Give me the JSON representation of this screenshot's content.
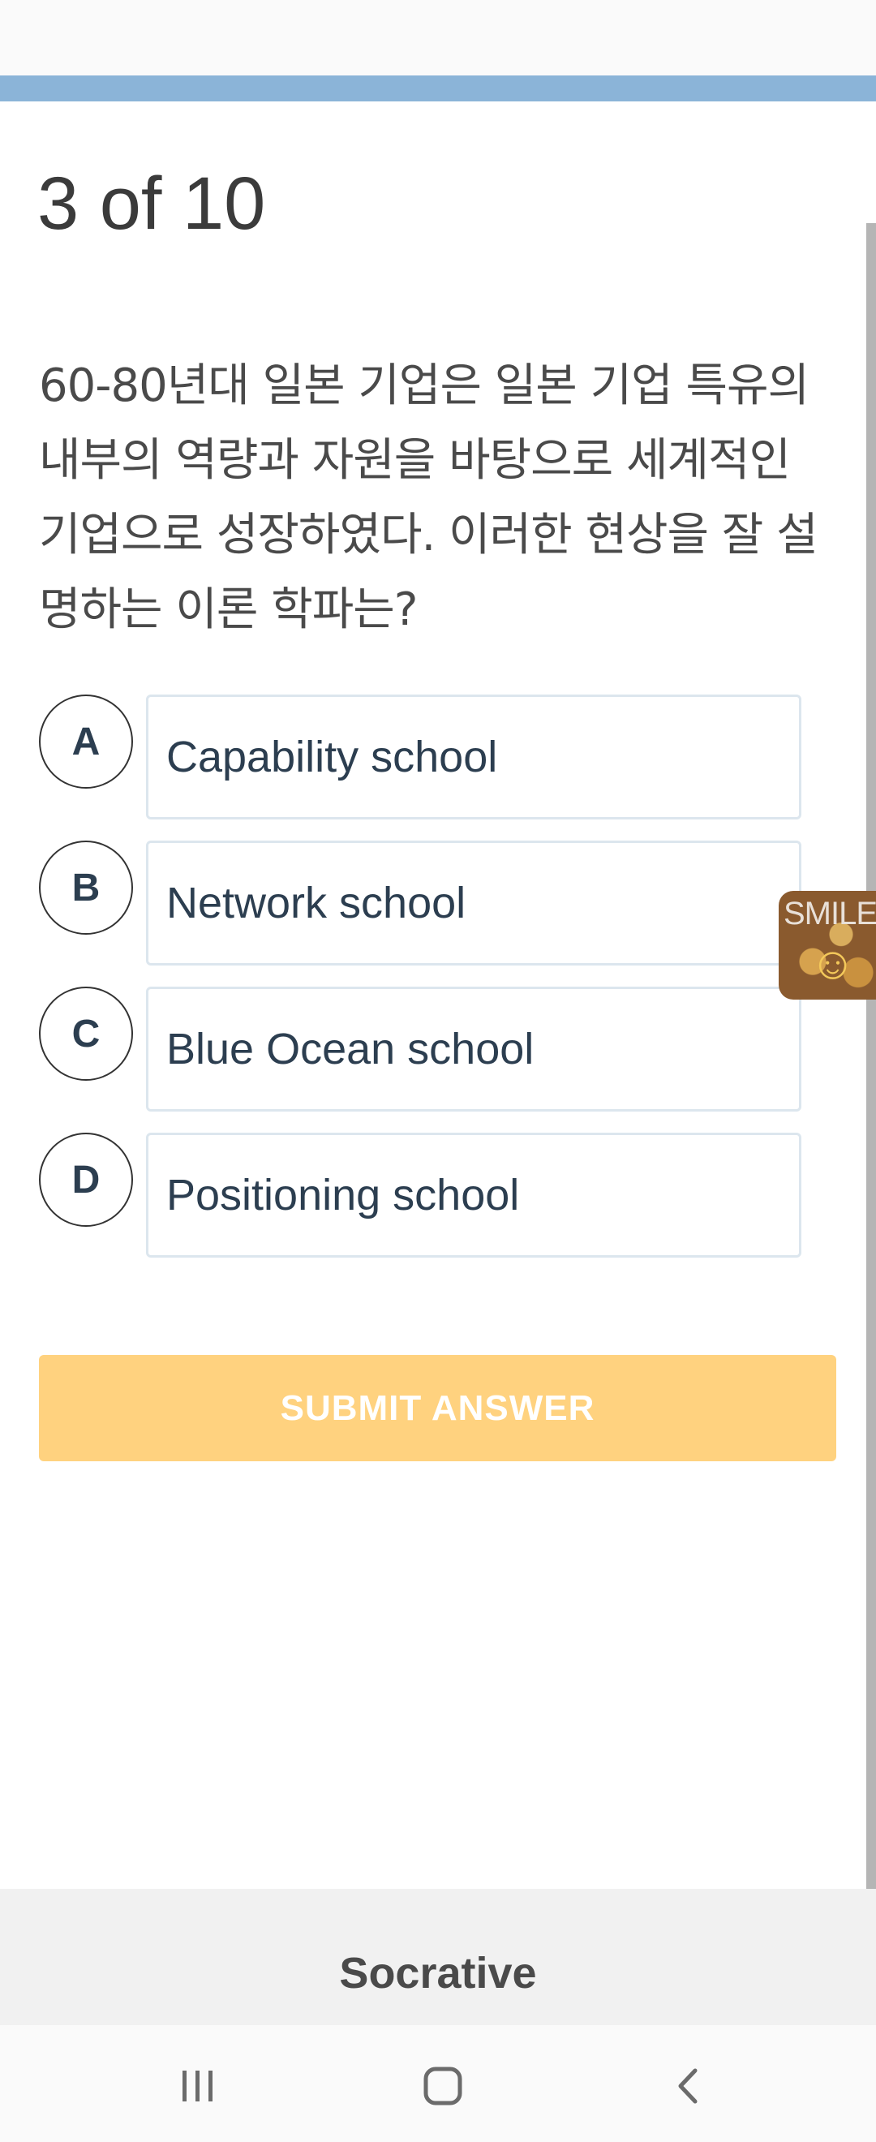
{
  "progress": {
    "current": 3,
    "total": 10,
    "fraction": 1.0
  },
  "question": {
    "counter": "3 of 10",
    "text": "60-80년대 일본 기업은 일본 기업 특유의 내부의 역량과 자원을 바탕으로 세계적인 기업으로 성장하였다. 이러한 현상을 잘 설명하는 이론 학파는?"
  },
  "options": [
    {
      "letter": "A",
      "text": "Capability school"
    },
    {
      "letter": "B",
      "text": "Network school"
    },
    {
      "letter": "C",
      "text": "Blue Ocean school"
    },
    {
      "letter": "D",
      "text": "Positioning school"
    }
  ],
  "submit_label": "SUBMIT ANSWER",
  "floating_widget": {
    "label": "SMILE"
  },
  "footer": {
    "brand": "Socrative"
  },
  "nav": {
    "icons": [
      "recent-apps-icon",
      "home-icon",
      "back-icon"
    ]
  },
  "colors": {
    "progress": "#8bb4d8",
    "submit": "#ffd27f",
    "option_border": "#dce6ee",
    "text_dark": "#2c3e50"
  }
}
